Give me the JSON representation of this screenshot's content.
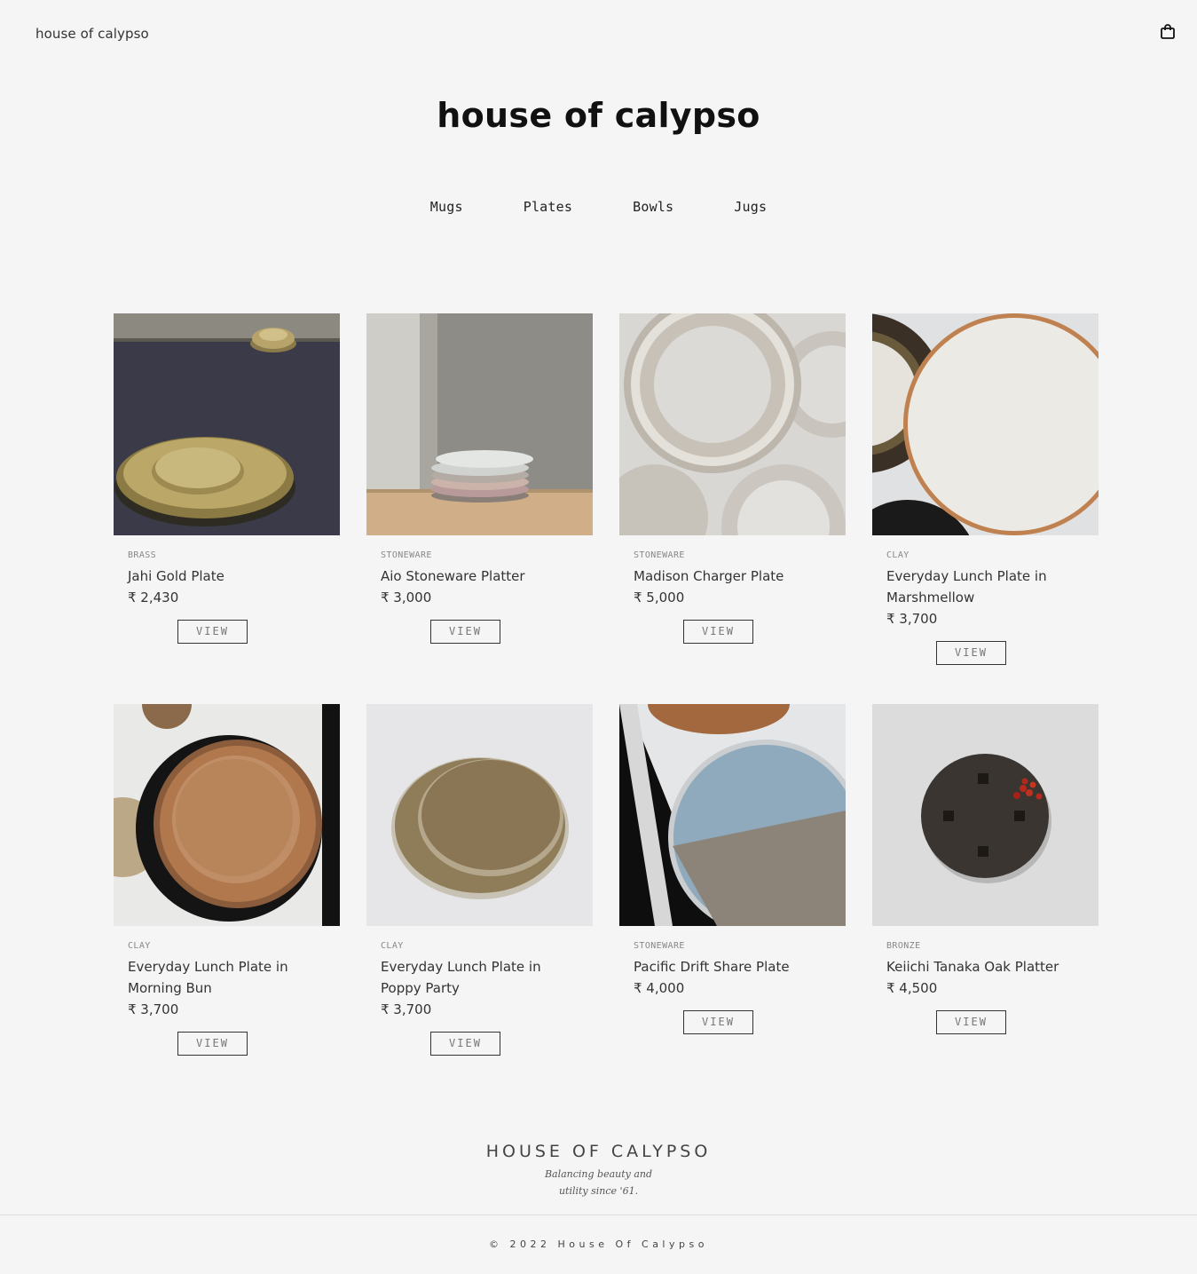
{
  "header": {
    "brand": "house of calypso",
    "cart_icon": "shopping-bag-icon"
  },
  "hero": {
    "title": "house of calypso"
  },
  "categories": [
    "Mugs",
    "Plates",
    "Bowls",
    "Jugs"
  ],
  "products": [
    {
      "material": "BRASS",
      "name": "Jahi Gold Plate",
      "price": "₹ 2,430",
      "button": "VIEW"
    },
    {
      "material": "STONEWARE",
      "name": "Aio Stoneware Platter",
      "price": "₹ 3,000",
      "button": "VIEW"
    },
    {
      "material": "STONEWARE",
      "name": "Madison Charger Plate",
      "price": "₹ 5,000",
      "button": "VIEW"
    },
    {
      "material": "CLAY",
      "name": "Everyday Lunch Plate in Marshmellow",
      "price": "₹ 3,700",
      "button": "VIEW"
    },
    {
      "material": "CLAY",
      "name": "Everyday Lunch Plate in Morning Bun",
      "price": "₹ 3,700",
      "button": "VIEW"
    },
    {
      "material": "CLAY",
      "name": "Everyday Lunch Plate in Poppy Party",
      "price": "₹ 3,700",
      "button": "VIEW"
    },
    {
      "material": "STONEWARE",
      "name": "Pacific Drift Share Plate",
      "price": "₹ 4,000",
      "button": "VIEW"
    },
    {
      "material": "BRONZE",
      "name": "Keiichi Tanaka Oak Platter",
      "price": "₹ 4,500",
      "button": "VIEW"
    }
  ],
  "footer": {
    "logo": "HOUSE OF CALYPSO",
    "tagline_line1": "Balancing beauty and",
    "tagline_line2": "utility since '61.",
    "copyright": "© 2022 House Of Calypso"
  }
}
